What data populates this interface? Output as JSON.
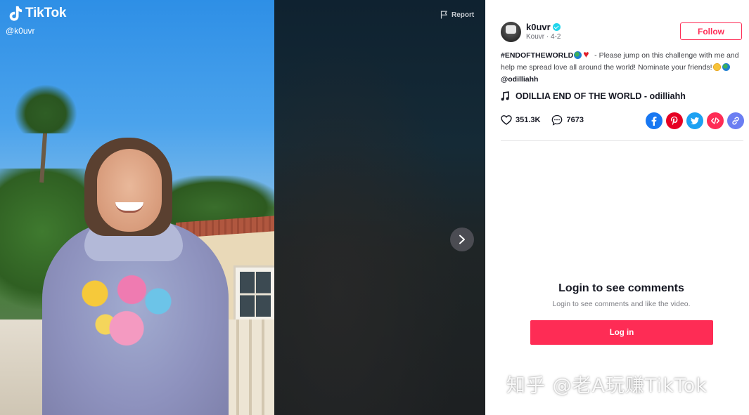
{
  "app": {
    "logo_text": "TikTok"
  },
  "video": {
    "author_handle": "@k0uvr",
    "report_label": "Report"
  },
  "author": {
    "username": "k0uvr",
    "subline": "Kouvr · 4-2",
    "follow_label": "Follow"
  },
  "description": {
    "hashtag": "#ENDOFTHEWORLD",
    "text": " - Please jump on this challenge with me and help me spread love all around the world! Nominate your friends!",
    "mention": "@odilliahh"
  },
  "music": {
    "title": "ODILLIA END OF THE WORLD - odilliahh"
  },
  "stats": {
    "likes": "351.3K",
    "comments": "7673"
  },
  "share_icons": [
    "facebook-icon",
    "pinterest-icon",
    "twitter-icon",
    "embed-icon",
    "link-icon"
  ],
  "comments": {
    "title": "Login to see comments",
    "subtitle": "Login to see comments and like the video.",
    "login_label": "Log in"
  },
  "watermark": {
    "text": "知乎 @老A玩赚TikTok"
  },
  "colors": {
    "accent": "#fe2c55",
    "verified": "#20d5ec"
  }
}
